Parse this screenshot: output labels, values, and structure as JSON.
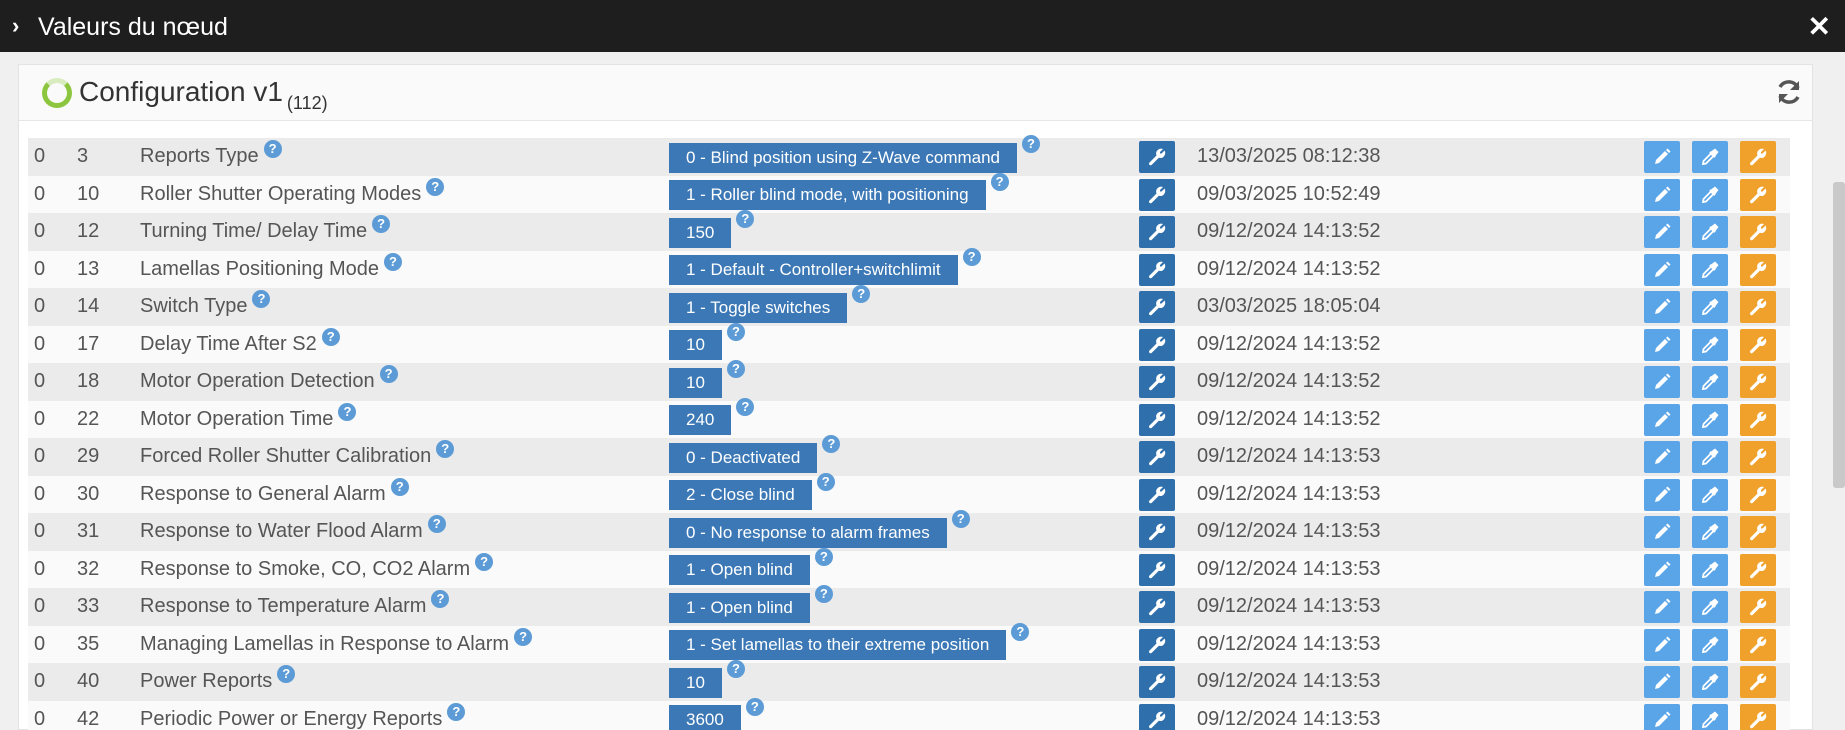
{
  "modal": {
    "title": "Valeurs du nœud",
    "close_glyph": "✕",
    "chevron_glyph": "›"
  },
  "panel": {
    "title": "Configuration v1",
    "count": "(112)"
  },
  "colors": {
    "value_badge": "#3b78b5",
    "wrench_button": "#2f6fab",
    "edit_button": "#5aa4e8",
    "config_button": "#f0a12b",
    "spinner": "#8cc63f"
  },
  "rows": [
    {
      "instance": "0",
      "param": "3",
      "name": "Reports Type",
      "value": "0 - Blind position using Z-Wave command",
      "date": "13/03/2025 08:12:38"
    },
    {
      "instance": "0",
      "param": "10",
      "name": "Roller Shutter Operating Modes",
      "value": "1 - Roller blind mode, with positioning",
      "date": "09/03/2025 10:52:49"
    },
    {
      "instance": "0",
      "param": "12",
      "name": "Turning Time/ Delay Time",
      "value": "150",
      "date": "09/12/2024 14:13:52"
    },
    {
      "instance": "0",
      "param": "13",
      "name": "Lamellas Positioning Mode",
      "value": "1 - Default - Controller+switchlimit",
      "date": "09/12/2024 14:13:52"
    },
    {
      "instance": "0",
      "param": "14",
      "name": "Switch Type",
      "value": "1 - Toggle switches",
      "date": "03/03/2025 18:05:04"
    },
    {
      "instance": "0",
      "param": "17",
      "name": "Delay Time After S2",
      "value": "10",
      "date": "09/12/2024 14:13:52"
    },
    {
      "instance": "0",
      "param": "18",
      "name": "Motor Operation Detection",
      "value": "10",
      "date": "09/12/2024 14:13:52"
    },
    {
      "instance": "0",
      "param": "22",
      "name": "Motor Operation Time",
      "value": "240",
      "date": "09/12/2024 14:13:52"
    },
    {
      "instance": "0",
      "param": "29",
      "name": "Forced Roller Shutter Calibration",
      "value": "0 - Deactivated",
      "date": "09/12/2024 14:13:53"
    },
    {
      "instance": "0",
      "param": "30",
      "name": "Response to General Alarm",
      "value": "2 - Close blind",
      "date": "09/12/2024 14:13:53"
    },
    {
      "instance": "0",
      "param": "31",
      "name": "Response to Water Flood Alarm",
      "value": "0 - No response to alarm frames",
      "date": "09/12/2024 14:13:53"
    },
    {
      "instance": "0",
      "param": "32",
      "name": "Response to Smoke, CO, CO2 Alarm",
      "value": "1 - Open blind",
      "date": "09/12/2024 14:13:53"
    },
    {
      "instance": "0",
      "param": "33",
      "name": "Response to Temperature Alarm",
      "value": "1 - Open blind",
      "date": "09/12/2024 14:13:53"
    },
    {
      "instance": "0",
      "param": "35",
      "name": "Managing Lamellas in Response to Alarm",
      "value": "1 - Set lamellas to their extreme position",
      "date": "09/12/2024 14:13:53"
    },
    {
      "instance": "0",
      "param": "40",
      "name": "Power Reports",
      "value": "10",
      "date": "09/12/2024 14:13:53"
    },
    {
      "instance": "0",
      "param": "42",
      "name": "Periodic Power or Energy Reports",
      "value": "3600",
      "date": "09/12/2024 14:13:53"
    }
  ]
}
